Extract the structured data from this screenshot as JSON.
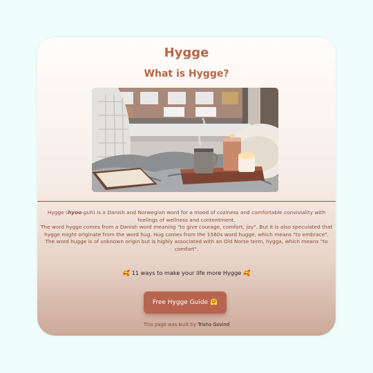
{
  "page": {
    "title": "Hygge",
    "subtitle": "What is Hygge?"
  },
  "description": {
    "word": "Hygge",
    "pronunciation_bold": "hyoo",
    "pronunciation_rest": "-guh",
    "line1_rest": "is a Danish and Norwegian word for a mood of coziness and comfortable conviviality with feelings of wellness and contentment.",
    "paragraph2": "The word hygge comes from a Danish word meaning \"to give courage, comfort, joy\". But it is also speculated that hygge might originate from the word hug. Hug comes from the 1560s word hugge, which means \"to embrace\". The word hugge is of unknown origin but is highly associated with an Old Norse term, hygga, which means \"to comfort\"."
  },
  "ways": {
    "emoji_left": "🥰",
    "text": "11 ways to make your life more Hygge",
    "emoji_right": "🥰"
  },
  "cta": {
    "label": "Free Hygge Guide 🤗"
  },
  "footer": {
    "prefix": "This page was built by",
    "author": "Trisha Govind"
  },
  "colors": {
    "accent": "#b56548",
    "button": "#b76450",
    "background": "#f0fdfd"
  }
}
